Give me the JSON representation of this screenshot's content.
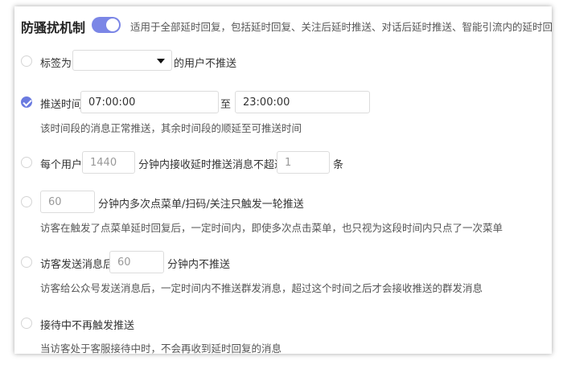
{
  "header": {
    "title": "防骚扰机制",
    "toggle_on": true,
    "description": "适用于全部延时回复，包括延时回复、关注后延时推送、对话后延时推送、智能引流内的延时回复等"
  },
  "rows": {
    "tag": {
      "prefix": "标签为",
      "select_value": "",
      "suffix": "的用户不推送",
      "checked": false
    },
    "time": {
      "label": "推送时间",
      "start": "07:00:00",
      "separator": "至",
      "end": "23:00:00",
      "hint": "该时间段的消息正常推送，其余时间段的顺延至可推送时间",
      "checked": true
    },
    "limit": {
      "prefix": "每个用户",
      "minutes": "1440",
      "middle": "分钟内接收延时推送消息不超过",
      "count": "1",
      "suffix": "条",
      "checked": false
    },
    "menu": {
      "minutes": "60",
      "text": "分钟内多次点菜单/扫码/关注只触发一轮推送",
      "hint": "访客在触发了点菜单延时回复后，一定时间内，即使多次点击菜单，也只视为这段时间内只点了一次菜单",
      "checked": false
    },
    "visitor": {
      "prefix": "访客发送消息后",
      "minutes": "60",
      "suffix": "分钟内不推送",
      "hint": "访客给公众号发送消息后，一定时间内不推送群发消息，超过这个时间之后才会接收推送的群发消息",
      "checked": false
    },
    "reception": {
      "label": "接待中不再触发推送",
      "hint": "当访客处于客服接待中时，不会再收到延时回复的消息",
      "checked": false
    }
  }
}
